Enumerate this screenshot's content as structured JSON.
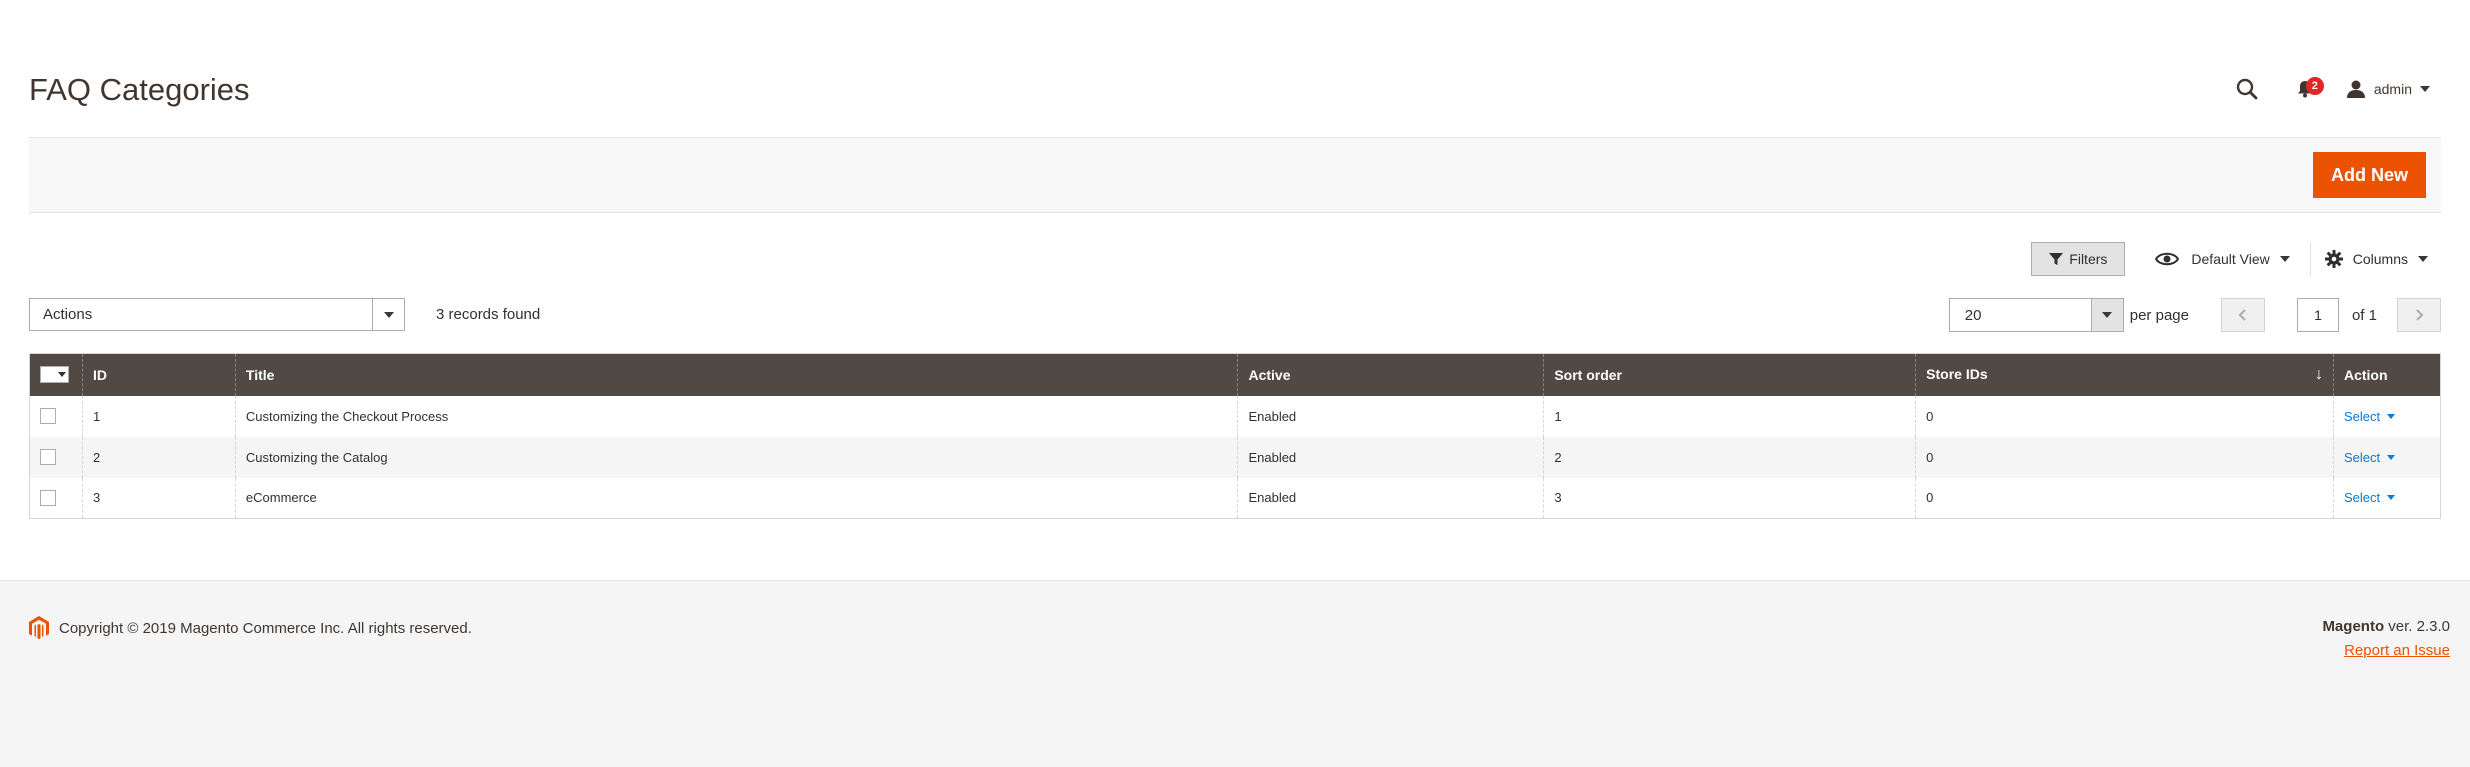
{
  "header": {
    "title": "FAQ Categories",
    "notifications_count": "2",
    "user_name": "admin"
  },
  "toolbar": {
    "add_new_label": "Add New"
  },
  "grid_controls": {
    "filters_label": "Filters",
    "view_label": "Default View",
    "columns_label": "Columns",
    "mass_actions_label": "Actions",
    "records_found": "3 records found",
    "per_page_value": "20",
    "per_page_label": "per page",
    "current_page": "1",
    "total_pages_label": "of 1"
  },
  "table": {
    "columns": [
      "ID",
      "Title",
      "Active",
      "Sort order",
      "Store IDs",
      "Action"
    ],
    "sort_indicator": "↓",
    "rows": [
      {
        "id": "1",
        "title": "Customizing the Checkout Process",
        "active": "Enabled",
        "sort_order": "1",
        "store_ids": "0",
        "action": "Select"
      },
      {
        "id": "2",
        "title": "Customizing the Catalog",
        "active": "Enabled",
        "sort_order": "2",
        "store_ids": "0",
        "action": "Select"
      },
      {
        "id": "3",
        "title": "eCommerce",
        "active": "Enabled",
        "sort_order": "3",
        "store_ids": "0",
        "action": "Select"
      }
    ]
  },
  "footer": {
    "copyright": "Copyright © 2019 Magento Commerce Inc. All rights reserved.",
    "brand": "Magento",
    "version": "ver. 2.3.0",
    "report_issue": "Report an Issue"
  },
  "colors": {
    "accent": "#eb5202",
    "table_header": "#514943",
    "link": "#007bdb",
    "badge": "#e22626"
  },
  "icons": [
    "search-icon",
    "bell-icon",
    "user-icon",
    "filter-icon",
    "eye-icon",
    "gear-icon",
    "magento-logo-icon"
  ]
}
